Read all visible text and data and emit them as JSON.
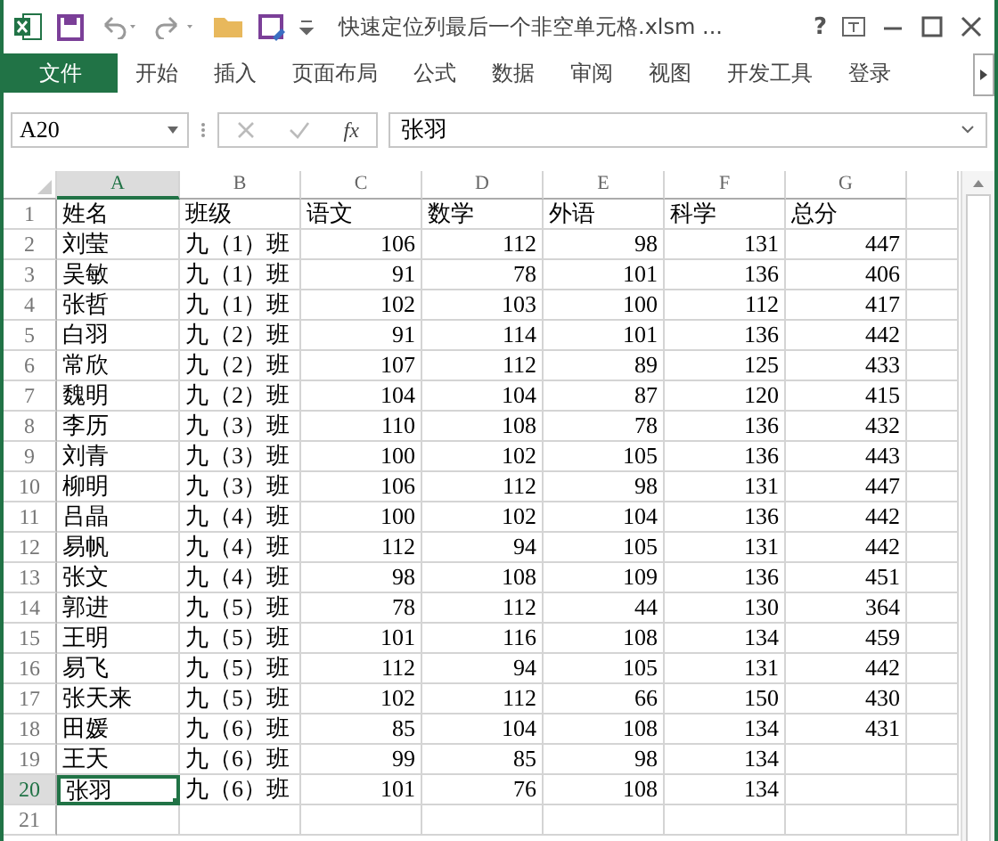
{
  "window": {
    "title": "快速定位列最后一个非空单元格.xlsm ...",
    "help": "?"
  },
  "ribbon_tabs": [
    {
      "label": "文件",
      "selected": true
    },
    {
      "label": "开始",
      "selected": false
    },
    {
      "label": "插入",
      "selected": false
    },
    {
      "label": "页面布局",
      "selected": false
    },
    {
      "label": "公式",
      "selected": false
    },
    {
      "label": "数据",
      "selected": false
    },
    {
      "label": "审阅",
      "selected": false
    },
    {
      "label": "视图",
      "selected": false
    },
    {
      "label": "开发工具",
      "selected": false
    },
    {
      "label": "登录",
      "selected": false
    }
  ],
  "formula_bar": {
    "name_box": "A20",
    "fx": "fx",
    "value": "张羽"
  },
  "columns": [
    {
      "label": "A",
      "selected": true
    },
    {
      "label": "B",
      "selected": false
    },
    {
      "label": "C",
      "selected": false
    },
    {
      "label": "D",
      "selected": false
    },
    {
      "label": "E",
      "selected": false
    },
    {
      "label": "F",
      "selected": false
    },
    {
      "label": "G",
      "selected": false
    }
  ],
  "rows": [
    {
      "number": "1",
      "selected": false,
      "cells": [
        "姓名",
        "班级",
        "语文",
        "数学",
        "外语",
        "科学",
        "总分"
      ]
    },
    {
      "number": "2",
      "selected": false,
      "cells": [
        "刘莹",
        "九（1）班",
        "106",
        "112",
        "98",
        "131",
        "447"
      ]
    },
    {
      "number": "3",
      "selected": false,
      "cells": [
        "吴敏",
        "九（1）班",
        "91",
        "78",
        "101",
        "136",
        "406"
      ]
    },
    {
      "number": "4",
      "selected": false,
      "cells": [
        "张哲",
        "九（1）班",
        "102",
        "103",
        "100",
        "112",
        "417"
      ]
    },
    {
      "number": "5",
      "selected": false,
      "cells": [
        "白羽",
        "九（2）班",
        "91",
        "114",
        "101",
        "136",
        "442"
      ]
    },
    {
      "number": "6",
      "selected": false,
      "cells": [
        "常欣",
        "九（2）班",
        "107",
        "112",
        "89",
        "125",
        "433"
      ]
    },
    {
      "number": "7",
      "selected": false,
      "cells": [
        "魏明",
        "九（2）班",
        "104",
        "104",
        "87",
        "120",
        "415"
      ]
    },
    {
      "number": "8",
      "selected": false,
      "cells": [
        "李历",
        "九（3）班",
        "110",
        "108",
        "78",
        "136",
        "432"
      ]
    },
    {
      "number": "9",
      "selected": false,
      "cells": [
        "刘青",
        "九（3）班",
        "100",
        "102",
        "105",
        "136",
        "443"
      ]
    },
    {
      "number": "10",
      "selected": false,
      "cells": [
        "柳明",
        "九（3）班",
        "106",
        "112",
        "98",
        "131",
        "447"
      ]
    },
    {
      "number": "11",
      "selected": false,
      "cells": [
        "吕晶",
        "九（4）班",
        "100",
        "102",
        "104",
        "136",
        "442"
      ]
    },
    {
      "number": "12",
      "selected": false,
      "cells": [
        "易帆",
        "九（4）班",
        "112",
        "94",
        "105",
        "131",
        "442"
      ]
    },
    {
      "number": "13",
      "selected": false,
      "cells": [
        "张文",
        "九（4）班",
        "98",
        "108",
        "109",
        "136",
        "451"
      ]
    },
    {
      "number": "14",
      "selected": false,
      "cells": [
        "郭进",
        "九（5）班",
        "78",
        "112",
        "44",
        "130",
        "364"
      ]
    },
    {
      "number": "15",
      "selected": false,
      "cells": [
        "王明",
        "九（5）班",
        "101",
        "116",
        "108",
        "134",
        "459"
      ]
    },
    {
      "number": "16",
      "selected": false,
      "cells": [
        "易飞",
        "九（5）班",
        "112",
        "94",
        "105",
        "131",
        "442"
      ]
    },
    {
      "number": "17",
      "selected": false,
      "cells": [
        "张天来",
        "九（5）班",
        "102",
        "112",
        "66",
        "150",
        "430"
      ]
    },
    {
      "number": "18",
      "selected": false,
      "cells": [
        "田媛",
        "九（6）班",
        "85",
        "104",
        "108",
        "134",
        "431"
      ]
    },
    {
      "number": "19",
      "selected": false,
      "cells": [
        "王天",
        "九（6）班",
        "99",
        "85",
        "98",
        "134"
      ]
    },
    {
      "number": "20",
      "selected": true,
      "cells": [
        "张羽",
        "九（6）班",
        "101",
        "76",
        "108",
        "134"
      ]
    },
    {
      "number": "21",
      "selected": false,
      "cells": []
    }
  ]
}
